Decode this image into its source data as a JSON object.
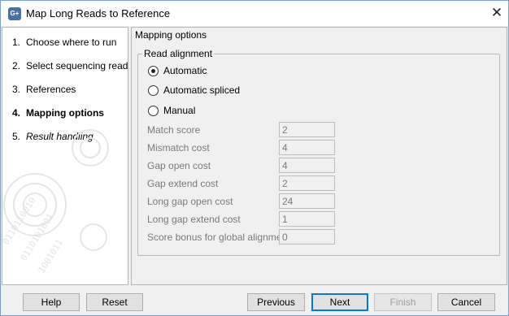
{
  "window": {
    "title": "Map Long Reads to Reference",
    "icon_text": "G+",
    "close_symbol": "✕"
  },
  "steps": [
    {
      "num": "1.",
      "label": "Choose where to run"
    },
    {
      "num": "2.",
      "label": "Select sequencing reads"
    },
    {
      "num": "3.",
      "label": "References"
    },
    {
      "num": "4.",
      "label": "Mapping options"
    },
    {
      "num": "5.",
      "label": "Result handling"
    }
  ],
  "panel": {
    "title": "Mapping options",
    "group_title": "Read alignment",
    "radios": [
      {
        "label": "Automatic",
        "checked": true
      },
      {
        "label": "Automatic spliced",
        "checked": false
      },
      {
        "label": "Manual",
        "checked": false
      }
    ],
    "fields": [
      {
        "label": "Match score",
        "value": "2"
      },
      {
        "label": "Mismatch cost",
        "value": "4"
      },
      {
        "label": "Gap open cost",
        "value": "4"
      },
      {
        "label": "Gap extend cost",
        "value": "2"
      },
      {
        "label": "Long gap open cost",
        "value": "24"
      },
      {
        "label": "Long gap extend cost",
        "value": "1"
      },
      {
        "label": "Score bonus for global alignment",
        "value": "0"
      }
    ]
  },
  "buttons": {
    "help": "Help",
    "reset": "Reset",
    "previous": "Previous",
    "next": "Next",
    "finish": "Finish",
    "cancel": "Cancel"
  }
}
